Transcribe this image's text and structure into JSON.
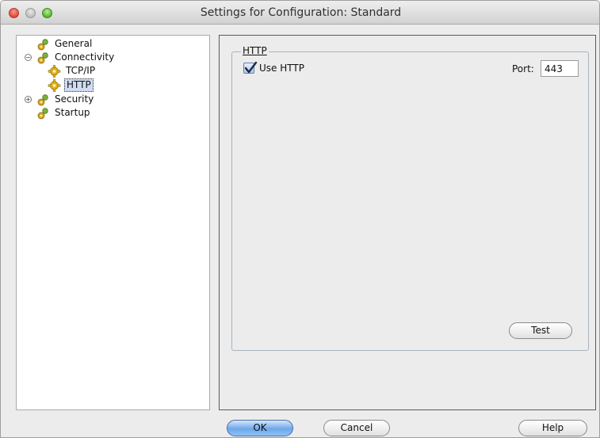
{
  "window": {
    "title": "Settings for Configuration: Standard"
  },
  "tree": {
    "items": [
      {
        "label": "General",
        "icon": "gear-group-icon",
        "expander": ""
      },
      {
        "label": "Connectivity",
        "icon": "gear-group-icon",
        "expander": "⊖"
      },
      {
        "label": "TCP/IP",
        "icon": "gear-icon",
        "expander": ""
      },
      {
        "label": "HTTP",
        "icon": "gear-icon",
        "expander": "",
        "selected": true
      },
      {
        "label": "Security",
        "icon": "gear-group-icon",
        "expander": "⊕"
      },
      {
        "label": "Startup",
        "icon": "gear-group-icon",
        "expander": ""
      }
    ]
  },
  "http_group": {
    "legend": "HTTP",
    "use_http_label": "Use HTTP",
    "use_http_checked": true,
    "port_label": "Port:",
    "port_value": "443",
    "test_label": "Test"
  },
  "footer": {
    "ok_label": "OK",
    "cancel_label": "Cancel",
    "help_label": "Help"
  },
  "colors": {
    "selection": "#cfdcf2",
    "default_button": "#6ea8ea",
    "icon_gold": "#e0b21d"
  }
}
